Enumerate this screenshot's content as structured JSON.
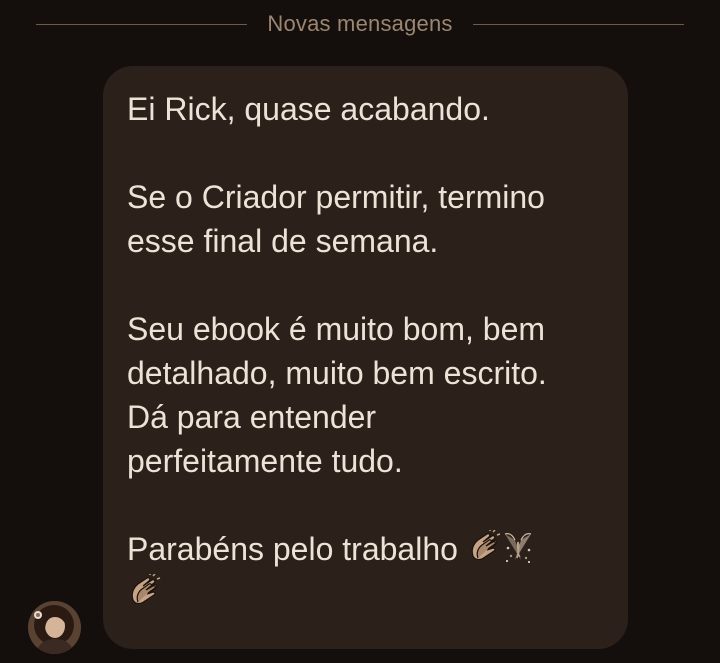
{
  "divider": {
    "label": "Novas mensagens"
  },
  "message": {
    "line1": "Ei Rick, quase acabando.",
    "line2a": "Se o Criador permitir, termino",
    "line2b": "esse final de semana.",
    "line3a": "Seu ebook é muito bom, bem",
    "line3b": "detalhado, muito bem escrito.",
    "line3c": "Dá para entender",
    "line3d": "perfeitamente tudo.",
    "line4": "Parabéns pelo trabalho",
    "emojis": [
      "clapping-hands",
      "party-popper",
      "clapping-hands"
    ]
  },
  "colors": {
    "background": "#140f0c",
    "bubble": "#2b211a",
    "text": "#ece2d6",
    "divider_text": "#9c8670",
    "divider_line": "#6e5a48"
  }
}
